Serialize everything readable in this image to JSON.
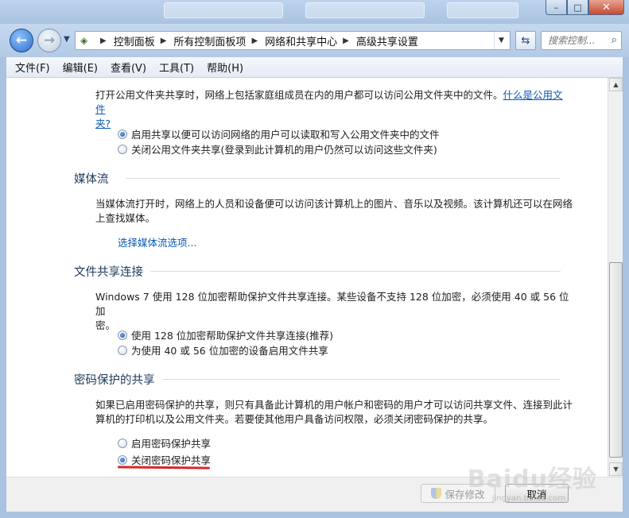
{
  "window": {
    "minimize_glyph": "–",
    "maximize_glyph": "□",
    "close_glyph": "✕"
  },
  "nav": {
    "back_glyph": "←",
    "forward_glyph": "→",
    "breadcrumb": [
      "控制面板",
      "所有控制面板项",
      "网络和共享中心",
      "高级共享设置"
    ],
    "search_placeholder": "搜索控制..."
  },
  "menu": [
    "文件(F)",
    "编辑(E)",
    "查看(V)",
    "工具(T)",
    "帮助(H)"
  ],
  "public_folder": {
    "desc_line1": "打开公用文件夹共享时，网络上包括家庭组成员在内的用户都可以访问公用文件夹中的文件。",
    "link_part1": "什么是公用文件",
    "link_part2": "夹?",
    "options": [
      {
        "label": "启用共享以便可以访问网络的用户可以读取和写入公用文件夹中的文件",
        "checked": true
      },
      {
        "label": "关闭公用文件夹共享(登录到此计算机的用户仍然可以访问这些文件夹)",
        "checked": false
      }
    ]
  },
  "media": {
    "title": "媒体流",
    "desc_line1": "当媒体流打开时，网络上的人员和设备便可以访问该计算机上的图片、音乐以及视频。该计算机还可以在网络",
    "desc_line2": "上查找媒体。",
    "link": "选择媒体流选项..."
  },
  "file_sharing": {
    "title": "文件共享连接",
    "desc_line1": "Windows 7 使用 128 位加密帮助保护文件共享连接。某些设备不支持 128 位加密，必须使用 40 或 56 位加",
    "desc_line2": "密。",
    "options": [
      {
        "label": "使用 128 位加密帮助保护文件共享连接(推荐)",
        "checked": true
      },
      {
        "label": "为使用 40 或 56 位加密的设备启用文件共享",
        "checked": false
      }
    ]
  },
  "password": {
    "title": "密码保护的共享",
    "desc_line1": "如果已启用密码保护的共享，则只有具备此计算机的用户帐户和密码的用户才可以访问共享文件、连接到此计",
    "desc_line2": "算机的打印机以及公用文件夹。若要使其他用户具备访问权限，必须关闭密码保护的共享。",
    "options": [
      {
        "label": "启用密码保护共享",
        "checked": false
      },
      {
        "label": "关闭密码保护共享",
        "checked": true
      }
    ]
  },
  "buttons": {
    "save": "保存修改",
    "cancel": "取消"
  },
  "watermark": {
    "brand": "Baidu经验",
    "url": "jingyan.baidu.com"
  },
  "colors": {
    "link": "#0b59b5",
    "section_title": "#1e395b",
    "annotation_underline": "#d9262b"
  }
}
